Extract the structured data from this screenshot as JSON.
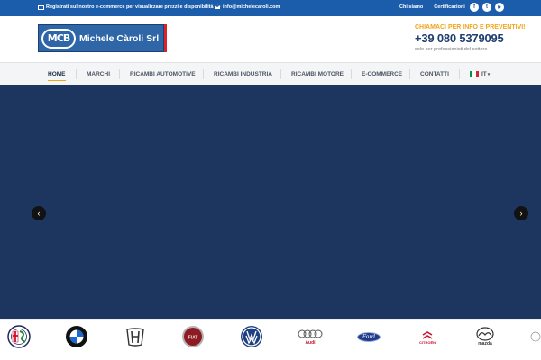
{
  "topbar": {
    "promo_text": "Registrati sul nostro e-commerce per visualizzare prezzi e disponibilità >>",
    "email": "info@michelecaroli.com",
    "links": [
      "Chi siamo",
      "Certificazioni"
    ],
    "social": [
      {
        "icon": "facebook-icon",
        "glyph": "f"
      },
      {
        "icon": "twitter-icon",
        "glyph": "t"
      },
      {
        "icon": "youtube-icon",
        "glyph": "▶"
      }
    ]
  },
  "header": {
    "logo_monogram": "MCB",
    "logo_text": "Michele Càroli Srl",
    "cta": "CHIAMACI PER INFO E PREVENTIVI!",
    "phone": "+39 080 5379095",
    "note": "solo per professionisti del settore"
  },
  "nav": {
    "items": [
      "HOME",
      "MARCHI",
      "RICAMBI AUTOMOTIVE",
      "RICAMBI INDUSTRIA",
      "RICAMBI MOTORE",
      "E-COMMERCE",
      "CONTATTI"
    ],
    "language": "IT",
    "active": "HOME"
  },
  "slider": {
    "prev_glyph": "‹",
    "next_glyph": "›"
  },
  "brands": {
    "logos": [
      "alfa-romeo-logo",
      "bmw-logo",
      "honda-logo",
      "fiat-logo",
      "volkswagen-logo",
      "audi-logo",
      "ford-logo",
      "citroen-logo",
      "mazda-logo"
    ],
    "audi_text": "Audi",
    "ford_text": "Ford",
    "citroen_text": "CITROËN",
    "mazda_text": "mazda",
    "fiat_text": "FIAT",
    "vw_text": "VW",
    "honda_text": "H",
    "bmw_text": "BMW"
  },
  "colors": {
    "topbar": "#1c5dab",
    "hero": "#1d3660",
    "accent": "#f2a51a",
    "phone": "#1f3d6e"
  }
}
